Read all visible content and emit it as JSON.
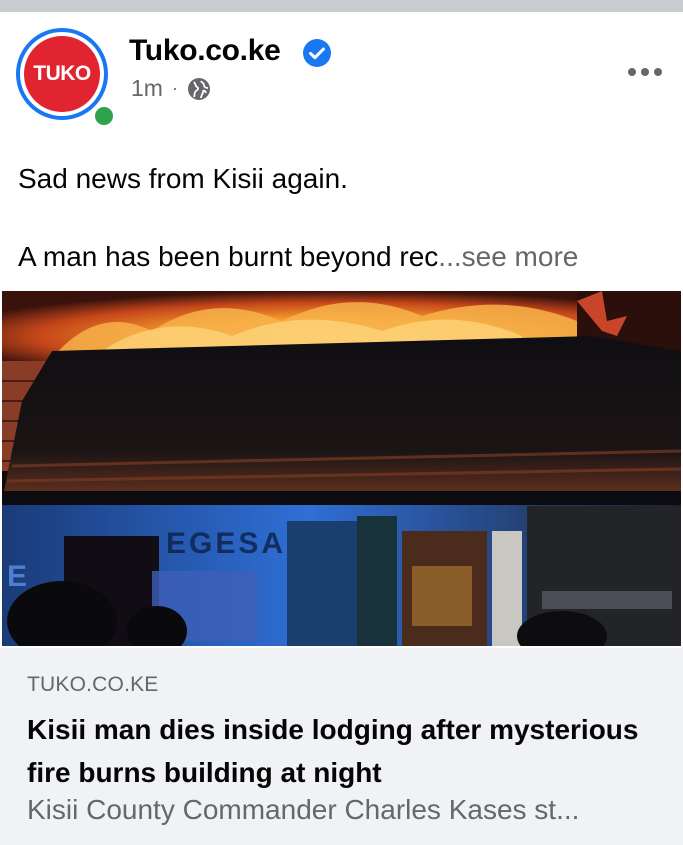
{
  "post": {
    "page_name": "Tuko.co.ke",
    "logo_text": "TUKO",
    "time": "1m",
    "separator": "·",
    "privacy_icon": "globe-icon",
    "verified_icon": "verified-badge-icon",
    "more_icon": "more-options-icon",
    "text_line1": "Sad news from Kisii again.",
    "text_line2": "A man has been burnt beyond rec",
    "see_more": "...see more"
  },
  "photo": {
    "sign_text": "EGESA",
    "left_sign_char": "E"
  },
  "link": {
    "domain": "TUKO.CO.KE",
    "title": "Kisii man dies inside lodging after mysterious fire burns building at night",
    "description": "Kisii County Commander Charles Kases st..."
  },
  "colors": {
    "brand_blue": "#1877f2",
    "logo_red": "#e02430",
    "online_green": "#31a24c",
    "secondary_text": "#65676b",
    "card_bg": "#f0f2f5"
  }
}
